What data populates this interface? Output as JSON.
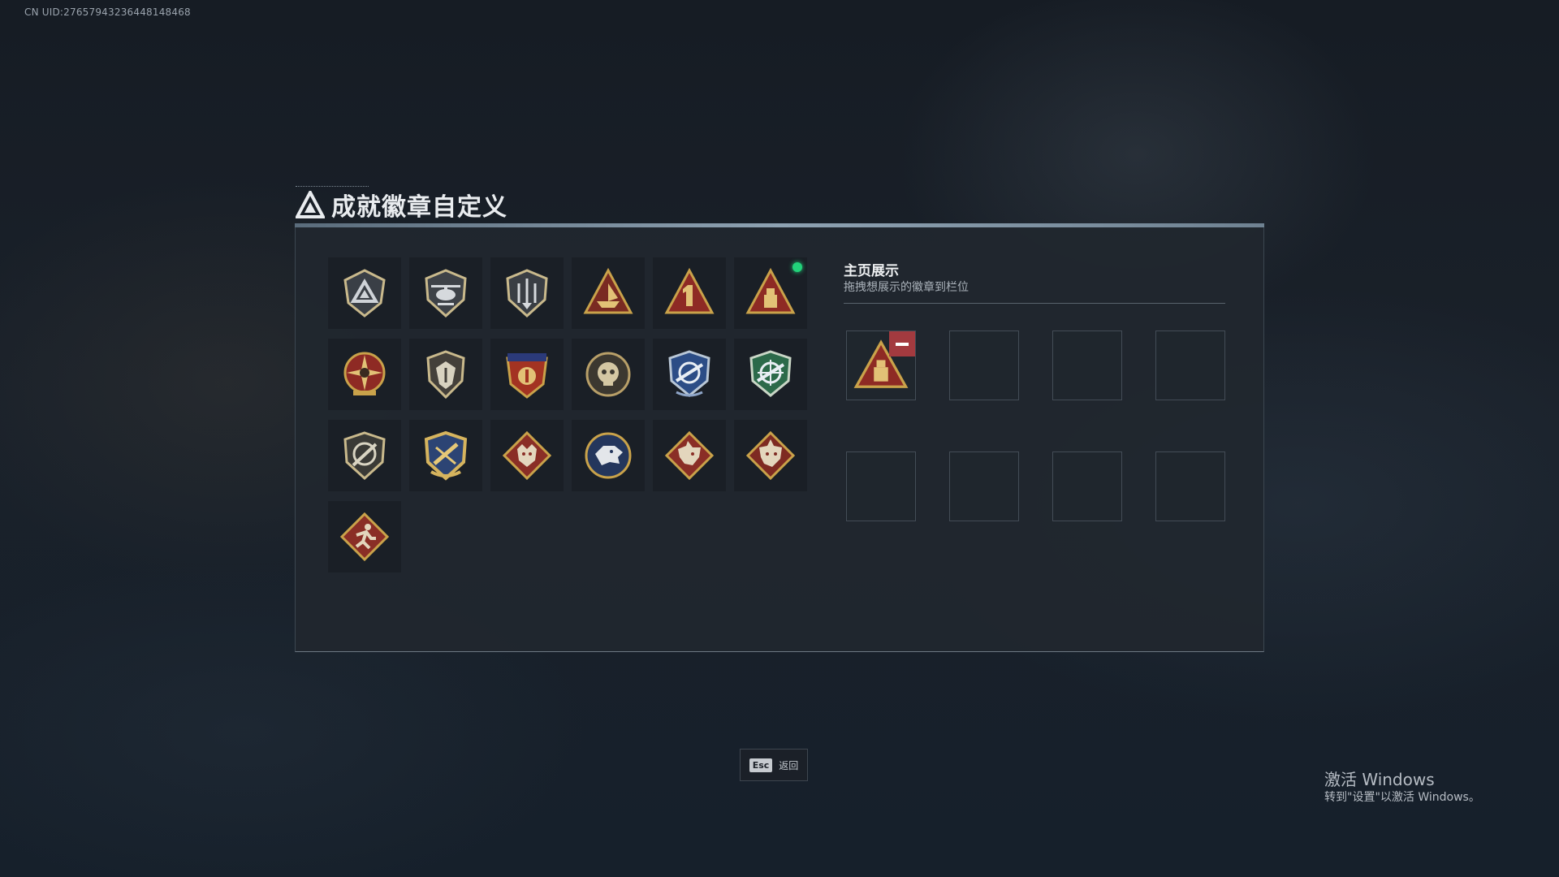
{
  "uid_text": "CN UID:276579432364481484​68",
  "header": {
    "title": "成就徽章自定义",
    "icon": "triangle-logo-icon"
  },
  "badges": [
    {
      "name": "triangle-shield-badge-icon",
      "new": false
    },
    {
      "name": "helicopter-shield-badge-icon",
      "new": false
    },
    {
      "name": "arrows-shield-badge-icon",
      "new": false
    },
    {
      "name": "boat-triangle-badge-icon",
      "new": false
    },
    {
      "name": "number-one-triangle-badge-icon",
      "new": false
    },
    {
      "name": "crate-triangle-badge-icon",
      "new": true
    },
    {
      "name": "star-compass-badge-icon",
      "new": false
    },
    {
      "name": "crest-shield-badge-icon",
      "new": false
    },
    {
      "name": "eagle-crest-badge-icon",
      "new": false
    },
    {
      "name": "skull-medallion-badge-icon",
      "new": false
    },
    {
      "name": "blue-rifle-shield-badge-icon",
      "new": false
    },
    {
      "name": "green-rifle-shield-badge-icon",
      "new": false
    },
    {
      "name": "rifle-shield-badge-icon",
      "new": false
    },
    {
      "name": "gold-rifle-shield-badge-icon",
      "new": false
    },
    {
      "name": "wolf-diamond-badge-icon",
      "new": false
    },
    {
      "name": "wolf-medallion-badge-icon",
      "new": false
    },
    {
      "name": "dragon-diamond-badge-icon",
      "new": false
    },
    {
      "name": "dragon-diamond-alt-badge-icon",
      "new": false
    },
    {
      "name": "runner-diamond-badge-icon",
      "new": false
    }
  ],
  "showcase": {
    "title": "主页展示",
    "subtitle": "拖拽想展示的徽章到栏位",
    "filled_slot_badge": "crate-triangle-badge-icon"
  },
  "footer": {
    "esc_key": "Esc",
    "esc_label": "返回"
  },
  "windows_activation": {
    "title": "激活 Windows",
    "subtitle": "转到\"设置\"以激活 Windows。"
  },
  "colors": {
    "accent_new": "#22d27a",
    "remove": "#a33a3f",
    "gold": "#c9a24a",
    "crimson": "#8e2a24"
  }
}
